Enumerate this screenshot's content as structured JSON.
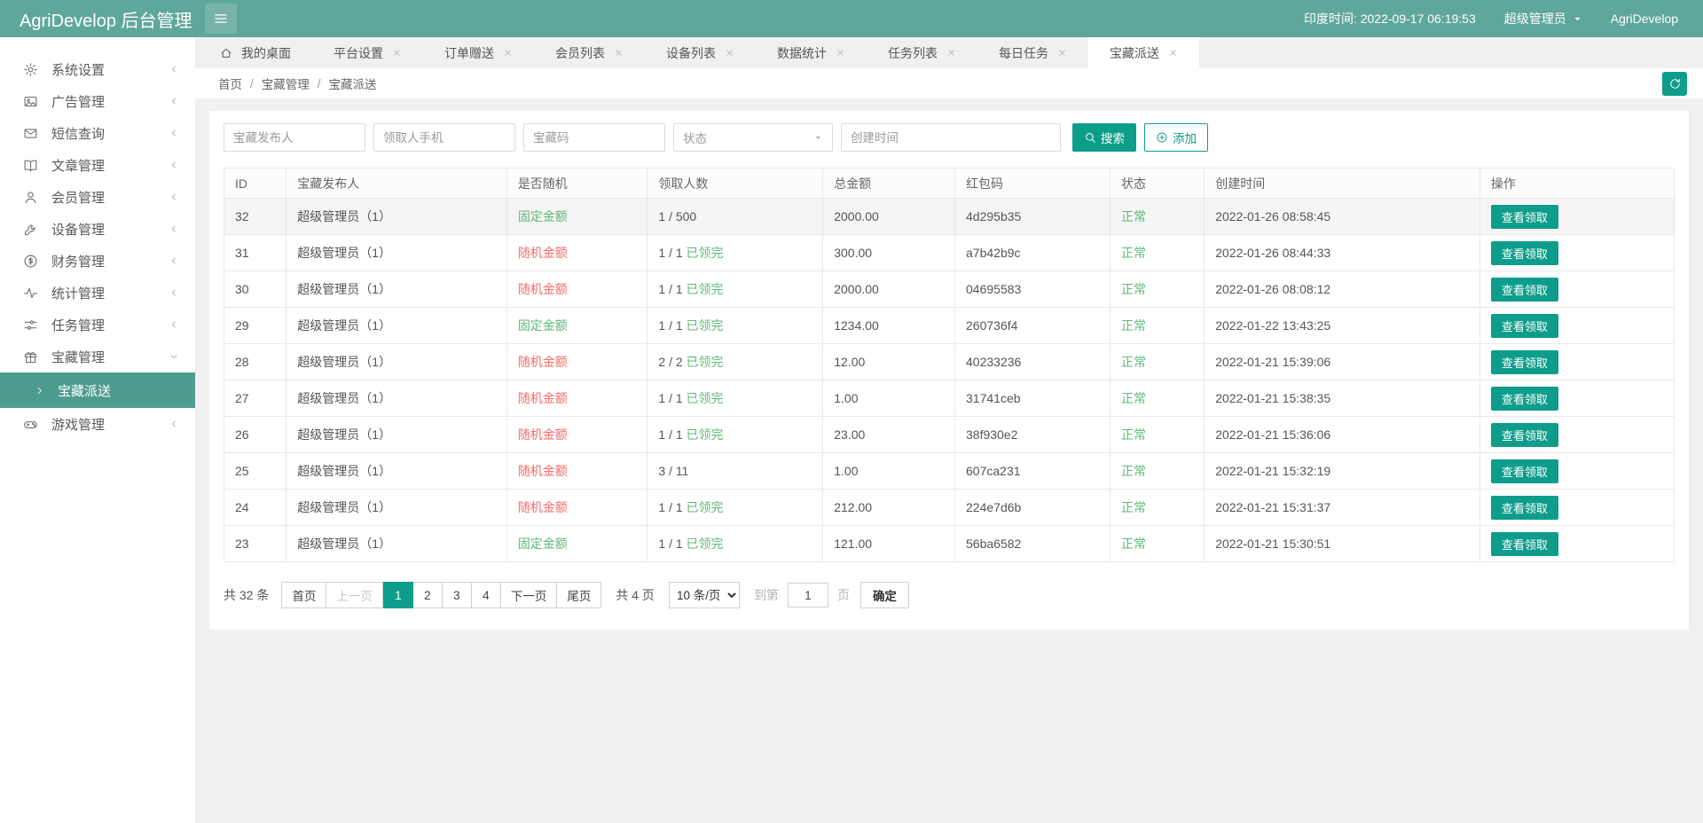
{
  "header": {
    "title": "AgriDevelop 后台管理",
    "time": "印度时间: 2022-09-17 06:19:53",
    "user": "超级管理员",
    "brand": "AgriDevelop"
  },
  "sidebar": {
    "items": [
      {
        "key": "system-settings",
        "label": "系统设置",
        "icon": "gear"
      },
      {
        "key": "ad-management",
        "label": "广告管理",
        "icon": "image"
      },
      {
        "key": "sms-query",
        "label": "短信查询",
        "icon": "mail"
      },
      {
        "key": "article-management",
        "label": "文章管理",
        "icon": "book"
      },
      {
        "key": "member-management",
        "label": "会员管理",
        "icon": "user"
      },
      {
        "key": "device-management",
        "label": "设备管理",
        "icon": "tools"
      },
      {
        "key": "finance-management",
        "label": "财务管理",
        "icon": "dollar"
      },
      {
        "key": "stats-management",
        "label": "统计管理",
        "icon": "activity"
      },
      {
        "key": "task-management",
        "label": "任务管理",
        "icon": "sliders"
      },
      {
        "key": "treasure-management",
        "label": "宝藏管理",
        "icon": "gift",
        "expanded": true,
        "children": [
          {
            "key": "treasure-delivery",
            "label": "宝藏派送",
            "active": true
          }
        ]
      },
      {
        "key": "game-management",
        "label": "游戏管理",
        "icon": "game"
      }
    ]
  },
  "tabs": [
    {
      "key": "my-desktop",
      "label": "我的桌面",
      "icon": "home",
      "closable": false,
      "active": false
    },
    {
      "key": "platform-settings",
      "label": "平台设置",
      "closable": true,
      "active": false
    },
    {
      "key": "order-gift",
      "label": "订单赠送",
      "closable": true,
      "active": false
    },
    {
      "key": "member-list",
      "label": "会员列表",
      "closable": true,
      "active": false
    },
    {
      "key": "device-list",
      "label": "设备列表",
      "closable": true,
      "active": false
    },
    {
      "key": "data-stats",
      "label": "数据统计",
      "closable": true,
      "active": false
    },
    {
      "key": "task-list",
      "label": "任务列表",
      "closable": true,
      "active": false
    },
    {
      "key": "daily-task",
      "label": "每日任务",
      "closable": true,
      "active": false
    },
    {
      "key": "treasure-delivery",
      "label": "宝藏派送",
      "closable": true,
      "active": true
    }
  ],
  "breadcrumb": {
    "items": [
      "首页",
      "宝藏管理",
      "宝藏派送"
    ],
    "separator": "/"
  },
  "filters": {
    "inputs": [
      {
        "placeholder": "宝藏发布人"
      },
      {
        "placeholder": "领取人手机"
      },
      {
        "placeholder": "宝藏码"
      }
    ],
    "select_placeholder": "状态",
    "date_placeholder": "创建时间",
    "search_label": "搜索",
    "add_label": "添加"
  },
  "table": {
    "columns": [
      "ID",
      "宝藏发布人",
      "是否随机",
      "领取人数",
      "总金额",
      "红包码",
      "状态",
      "创建时间",
      "操作"
    ],
    "action_label": "查看领取",
    "rows": [
      {
        "id": "32",
        "publisher": "超级管理员（1）",
        "random": "固定金额",
        "random_type": "fixed",
        "claims": "1 / 500",
        "claims_done": "",
        "amount": "2000.00",
        "code": "4d295b35",
        "status": "正常",
        "created": "2022-01-26 08:58:45",
        "highlight": true
      },
      {
        "id": "31",
        "publisher": "超级管理员（1）",
        "random": "随机金额",
        "random_type": "random",
        "claims": "1 / 1",
        "claims_done": "已领完",
        "amount": "300.00",
        "code": "a7b42b9c",
        "status": "正常",
        "created": "2022-01-26 08:44:33",
        "highlight": false
      },
      {
        "id": "30",
        "publisher": "超级管理员（1）",
        "random": "随机金额",
        "random_type": "random",
        "claims": "1 / 1",
        "claims_done": "已领完",
        "amount": "2000.00",
        "code": "04695583",
        "status": "正常",
        "created": "2022-01-26 08:08:12",
        "highlight": false
      },
      {
        "id": "29",
        "publisher": "超级管理员（1）",
        "random": "固定金额",
        "random_type": "fixed",
        "claims": "1 / 1",
        "claims_done": "已领完",
        "amount": "1234.00",
        "code": "260736f4",
        "status": "正常",
        "created": "2022-01-22 13:43:25",
        "highlight": false
      },
      {
        "id": "28",
        "publisher": "超级管理员（1）",
        "random": "随机金额",
        "random_type": "random",
        "claims": "2 / 2",
        "claims_done": "已领完",
        "amount": "12.00",
        "code": "40233236",
        "status": "正常",
        "created": "2022-01-21 15:39:06",
        "highlight": false
      },
      {
        "id": "27",
        "publisher": "超级管理员（1）",
        "random": "随机金额",
        "random_type": "random",
        "claims": "1 / 1",
        "claims_done": "已领完",
        "amount": "1.00",
        "code": "31741ceb",
        "status": "正常",
        "created": "2022-01-21 15:38:35",
        "highlight": false
      },
      {
        "id": "26",
        "publisher": "超级管理员（1）",
        "random": "随机金额",
        "random_type": "random",
        "claims": "1 / 1",
        "claims_done": "已领完",
        "amount": "23.00",
        "code": "38f930e2",
        "status": "正常",
        "created": "2022-01-21 15:36:06",
        "highlight": false
      },
      {
        "id": "25",
        "publisher": "超级管理员（1）",
        "random": "随机金额",
        "random_type": "random",
        "claims": "3 / 11",
        "claims_done": "",
        "amount": "1.00",
        "code": "607ca231",
        "status": "正常",
        "created": "2022-01-21 15:32:19",
        "highlight": false
      },
      {
        "id": "24",
        "publisher": "超级管理员（1）",
        "random": "随机金额",
        "random_type": "random",
        "claims": "1 / 1",
        "claims_done": "已领完",
        "amount": "212.00",
        "code": "224e7d6b",
        "status": "正常",
        "created": "2022-01-21 15:31:37",
        "highlight": false
      },
      {
        "id": "23",
        "publisher": "超级管理员（1）",
        "random": "固定金额",
        "random_type": "fixed",
        "claims": "1 / 1",
        "claims_done": "已领完",
        "amount": "121.00",
        "code": "56ba6582",
        "status": "正常",
        "created": "2022-01-21 15:30:51",
        "highlight": false
      }
    ]
  },
  "pagination": {
    "total_label": "共 32 条",
    "first": "首页",
    "prev": "上一页",
    "pages": [
      "1",
      "2",
      "3",
      "4"
    ],
    "active_page": "1",
    "next": "下一页",
    "last": "尾页",
    "page_count_label": "共 4 页",
    "per_page": "10 条/页",
    "goto_prefix": "到第",
    "goto_value": "1",
    "goto_suffix": "页",
    "confirm": "确定"
  },
  "colors": {
    "header": "#5FA79B",
    "primary": "#0E9D8B",
    "subactive": "#4D9C8E",
    "red": "#F56C6C",
    "green": "#5FB878"
  }
}
